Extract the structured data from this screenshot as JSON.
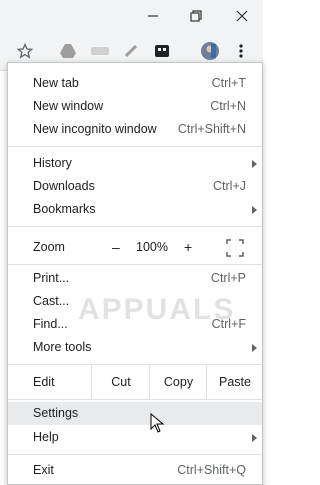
{
  "menu": {
    "new_tab": {
      "label": "New tab",
      "shortcut": "Ctrl+T"
    },
    "new_window": {
      "label": "New window",
      "shortcut": "Ctrl+N"
    },
    "new_incognito": {
      "label": "New incognito window",
      "shortcut": "Ctrl+Shift+N"
    },
    "history": {
      "label": "History"
    },
    "downloads": {
      "label": "Downloads",
      "shortcut": "Ctrl+J"
    },
    "bookmarks": {
      "label": "Bookmarks"
    },
    "zoom": {
      "label": "Zoom",
      "minus": "–",
      "value": "100%",
      "plus": "+"
    },
    "print": {
      "label": "Print...",
      "shortcut": "Ctrl+P"
    },
    "cast": {
      "label": "Cast..."
    },
    "find": {
      "label": "Find...",
      "shortcut": "Ctrl+F"
    },
    "more_tools": {
      "label": "More tools"
    },
    "edit": {
      "label": "Edit",
      "cut": "Cut",
      "copy": "Copy",
      "paste": "Paste"
    },
    "settings": {
      "label": "Settings"
    },
    "help": {
      "label": "Help"
    },
    "exit": {
      "label": "Exit",
      "shortcut": "Ctrl+Shift+Q"
    }
  },
  "watermark": "APPUALS",
  "icons": [
    "minimize-icon",
    "restore-icon",
    "close-icon",
    "star-icon",
    "drive-icon",
    "extension-icon",
    "pen-icon",
    "media-icon",
    "avatar",
    "menu-dots-icon",
    "fullscreen-icon",
    "cursor-icon"
  ]
}
